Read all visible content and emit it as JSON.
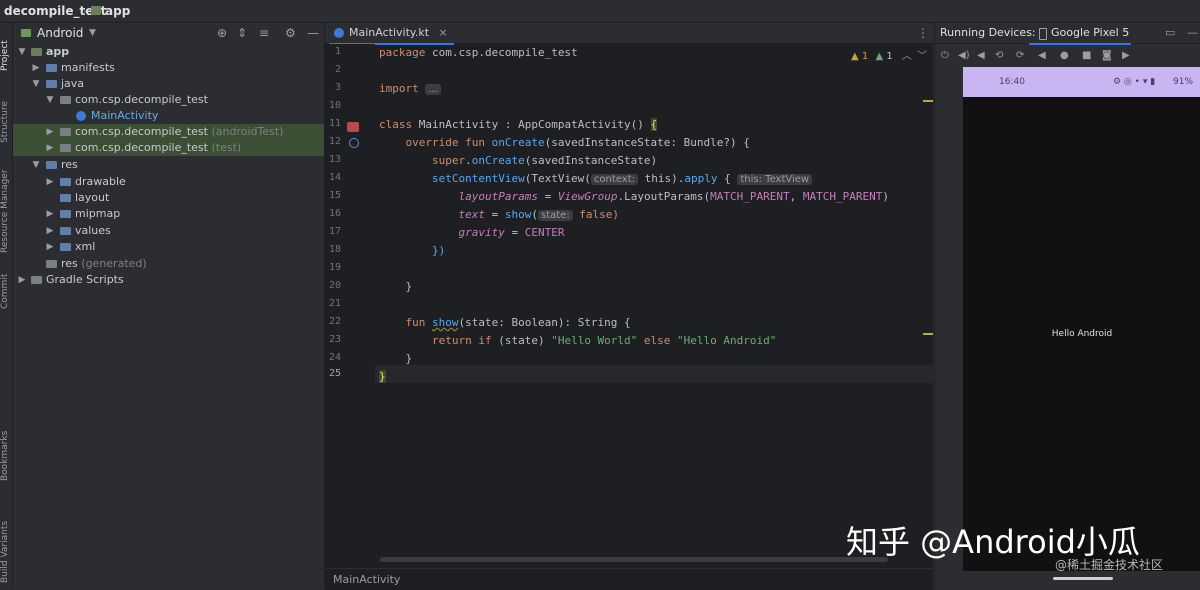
{
  "breadcrumb": {
    "project": "decompile_test",
    "module": "app"
  },
  "sidebar_strip": {
    "top": [
      "Project",
      "Structure",
      "Resource Manager",
      "Commit"
    ],
    "bottom": [
      "Bookmarks",
      "Build Variants"
    ]
  },
  "project_panel": {
    "view": "Android",
    "tree": [
      {
        "label": "app",
        "suffix": ""
      },
      {
        "label": "manifests",
        "suffix": ""
      },
      {
        "label": "java",
        "suffix": ""
      },
      {
        "label": "com.csp.decompile_test",
        "suffix": ""
      },
      {
        "label": "MainActivity",
        "suffix": ""
      },
      {
        "label": "com.csp.decompile_test",
        "suffix": "(androidTest)"
      },
      {
        "label": "com.csp.decompile_test",
        "suffix": "(test)"
      },
      {
        "label": "res",
        "suffix": ""
      },
      {
        "label": "drawable",
        "suffix": ""
      },
      {
        "label": "layout",
        "suffix": ""
      },
      {
        "label": "mipmap",
        "suffix": ""
      },
      {
        "label": "values",
        "suffix": ""
      },
      {
        "label": "xml",
        "suffix": ""
      },
      {
        "label": "res",
        "suffix": "(generated)"
      },
      {
        "label": "Gradle Scripts",
        "suffix": ""
      }
    ]
  },
  "editor": {
    "tab": "MainActivity.kt",
    "warnings": "1",
    "weak_warnings": "1",
    "status": "MainActivity",
    "line_numbers": [
      "1",
      "2",
      "3",
      "10",
      "11",
      "12",
      "13",
      "14",
      "15",
      "16",
      "17",
      "18",
      "19",
      "20",
      "21",
      "22",
      "23",
      "24",
      "25"
    ],
    "code": {
      "l1_a": "package ",
      "l1_b": "com.csp.decompile_test",
      "l3_a": "import ",
      "l3_b": "...",
      "l11_a": "class ",
      "l11_b": "MainActivity : AppCompatActivity() ",
      "l11_c": "{",
      "l12_a": "    override fun ",
      "l12_b": "onCreate",
      "l12_c": "(savedInstanceState: Bundle?) {",
      "l13_a": "        super",
      "l13_b": ".",
      "l13_c": "onCreate",
      "l13_d": "(savedInstanceState)",
      "l14_a": "        ",
      "l14_b": "setContentView",
      "l14_c": "(TextView(",
      "l14_hint1": "context:",
      "l14_d": " this).",
      "l14_e": "apply",
      "l14_f": " { ",
      "l14_hint2": "this: TextView",
      "l15_a": "            ",
      "l15_b": "layoutParams",
      "l15_c": " = ",
      "l15_d": "ViewGroup",
      "l15_e": ".LayoutParams(",
      "l15_f": "MATCH_PARENT",
      "l15_g": ", ",
      "l15_h": "MATCH_PARENT",
      "l15_i": ")",
      "l16_a": "            ",
      "l16_b": "text",
      "l16_c": " = ",
      "l16_d": "show",
      "l16_e": "(",
      "l16_hint": "state:",
      "l16_f": " false)",
      "l17_a": "            ",
      "l17_b": "gravity",
      "l17_c": " = ",
      "l17_d": "CENTER",
      "l18": "        })",
      "l20": "    }",
      "l22_a": "    fun ",
      "l22_b": "show",
      "l22_c": "(state: Boolean): String {",
      "l23_a": "        return if ",
      "l23_b": "(state) ",
      "l23_c": "\"Hello World\"",
      "l23_d": " else ",
      "l23_e": "\"Hello Android\"",
      "l24": "    }",
      "l25": "}"
    }
  },
  "device_panel": {
    "title": "Running Devices:",
    "device": "Google Pixel 5",
    "phone_time": "16:40",
    "phone_battery": "91%",
    "app_text": "Hello Android"
  },
  "watermark": {
    "main": "知乎 @Android小瓜",
    "sub": "@稀土掘金技术社区"
  }
}
